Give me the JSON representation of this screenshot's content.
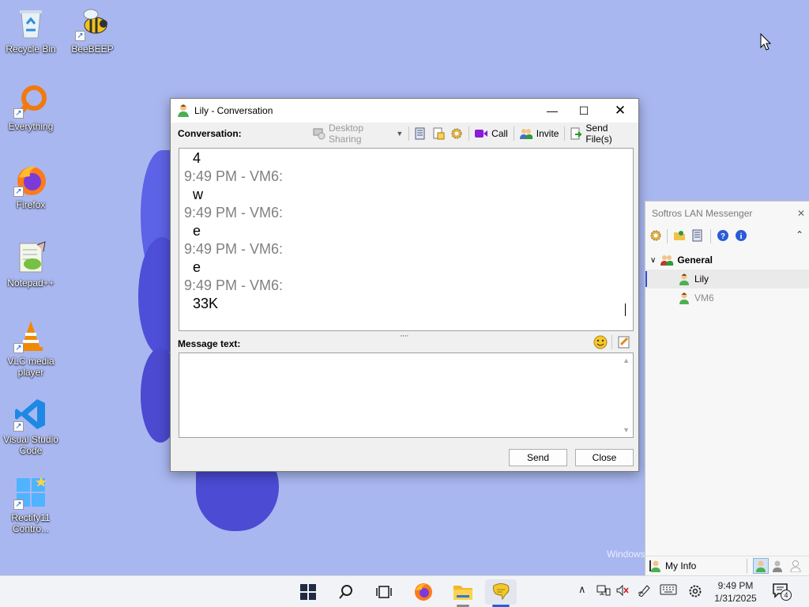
{
  "desktop": {
    "watermark": "Windows",
    "icons": [
      {
        "label": "Recycle Bin",
        "icon": "recycle-bin-icon"
      },
      {
        "label": "BeeBEEP",
        "icon": "bee-icon"
      },
      {
        "label": "Everything",
        "icon": "magnifier-icon"
      },
      {
        "label": "Firefox",
        "icon": "firefox-icon"
      },
      {
        "label": "Notepad++",
        "icon": "notepad-icon"
      },
      {
        "label": "VLC media player",
        "icon": "vlc-cone-icon"
      },
      {
        "label": "Visual Studio Code",
        "icon": "vscode-icon"
      },
      {
        "label": "Rectify11 Contro...",
        "icon": "control-panel-icon"
      }
    ]
  },
  "conversation": {
    "title": "Lily - Conversation",
    "conversation_label": "Conversation:",
    "toolbar": {
      "desktop_sharing": "Desktop Sharing",
      "call": "Call",
      "invite": "Invite",
      "send_files": "Send File(s)"
    },
    "messages": [
      {
        "type": "body",
        "text": "4"
      },
      {
        "type": "meta",
        "text": "9:49 PM - VM6:"
      },
      {
        "type": "body",
        "text": "w"
      },
      {
        "type": "meta",
        "text": "9:49 PM - VM6:"
      },
      {
        "type": "body",
        "text": "e"
      },
      {
        "type": "meta",
        "text": "9:49 PM - VM6:"
      },
      {
        "type": "body",
        "text": "e"
      },
      {
        "type": "meta",
        "text": "9:49 PM - VM6:"
      },
      {
        "type": "body",
        "text": "33K"
      }
    ],
    "message_label": "Message text:",
    "message_value": "",
    "send_button": "Send",
    "close_button": "Close"
  },
  "softros": {
    "title": "Softros LAN Messenger",
    "group": "General",
    "users": [
      {
        "name": "Lily",
        "status": "online"
      },
      {
        "name": "VM6",
        "status": "self"
      }
    ],
    "my_info": "My Info"
  },
  "taskbar": {
    "time": "9:49 PM",
    "date": "1/31/2025",
    "notification_count": "4"
  },
  "colors": {
    "wallpaper": "#a9b7f0",
    "meta_text": "#808080",
    "call_icon": "#8a1cd6"
  }
}
